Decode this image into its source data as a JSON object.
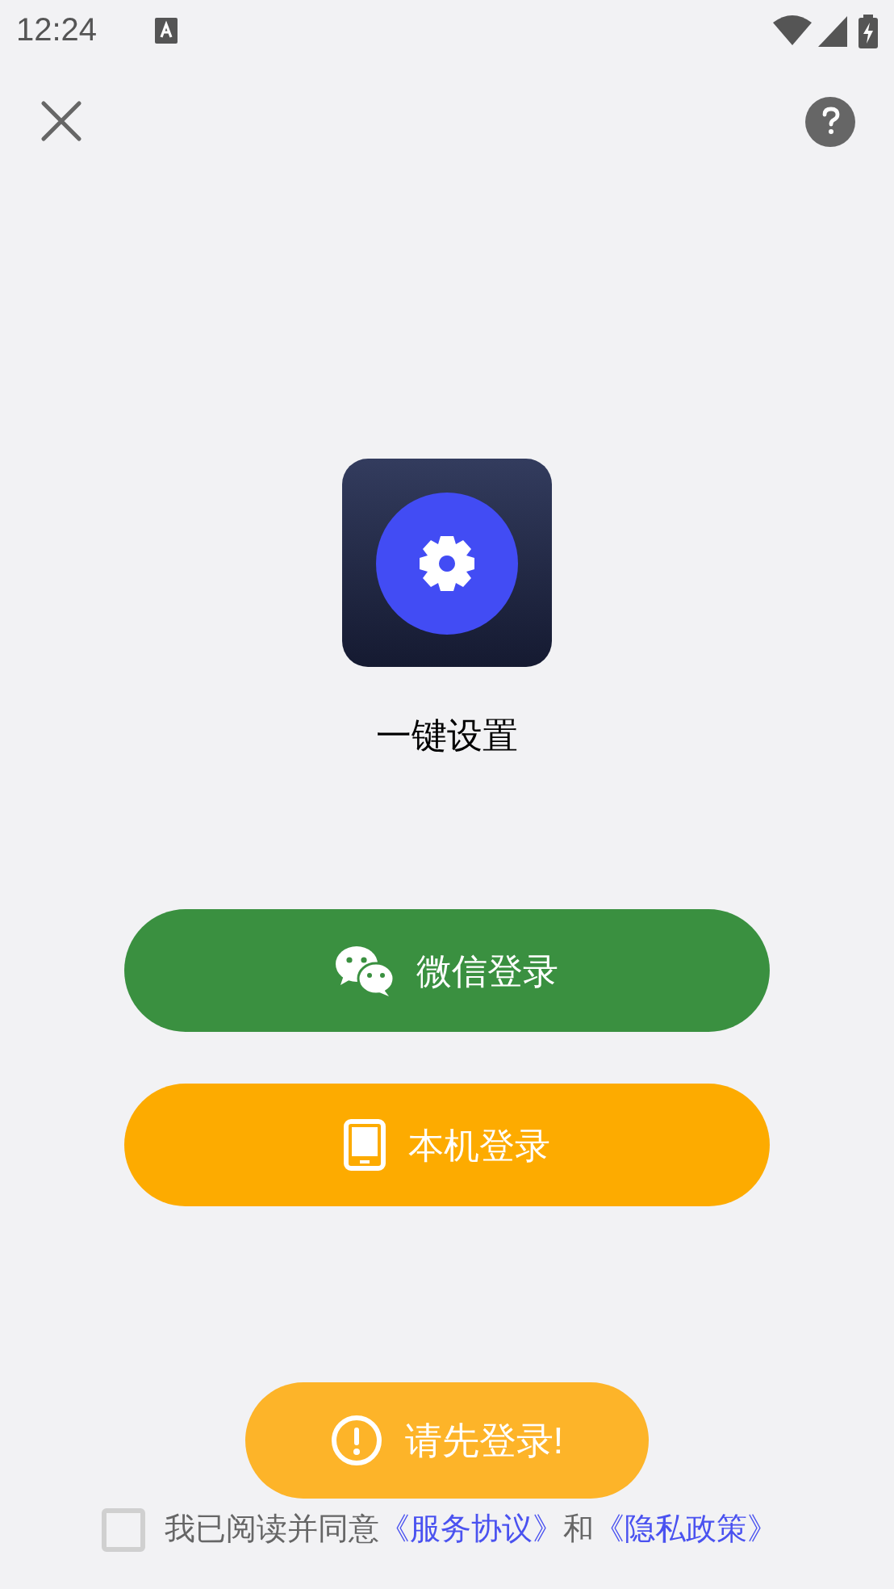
{
  "status_bar": {
    "time": "12:24"
  },
  "app": {
    "title": "一键设置"
  },
  "login_buttons": [
    {
      "kind": "wechat",
      "label": "微信登录"
    },
    {
      "kind": "phone",
      "label": "本机登录"
    }
  ],
  "agreement": {
    "checked": false,
    "text": "我已阅读并同意",
    "link_1": "《服务协议》",
    "joiner": "和",
    "link_2": "《隐私政策》"
  },
  "toast": {
    "message": "请先登录!"
  }
}
